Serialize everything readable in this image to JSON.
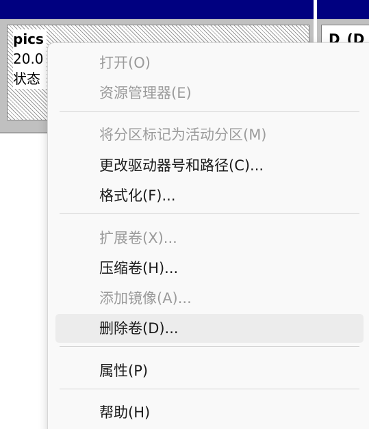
{
  "disk": {
    "volume_name": "pics",
    "volume_size_fragment": "20.0",
    "volume_status_fragment": "状态",
    "right_volume_fragment": "D_(D"
  },
  "menu": {
    "items": [
      {
        "label": "打开(O)",
        "enabled": false
      },
      {
        "label": "资源管理器(E)",
        "enabled": false
      },
      {
        "label": "将分区标记为活动分区(M)",
        "enabled": false
      },
      {
        "label": "更改驱动器号和路径(C)...",
        "enabled": true
      },
      {
        "label": "格式化(F)...",
        "enabled": true
      },
      {
        "label": "扩展卷(X)...",
        "enabled": false
      },
      {
        "label": "压缩卷(H)...",
        "enabled": true
      },
      {
        "label": "添加镜像(A)...",
        "enabled": false
      },
      {
        "label": "删除卷(D)...",
        "enabled": true,
        "highlighted": true
      },
      {
        "label": "属性(P)",
        "enabled": true
      },
      {
        "label": "帮助(H)",
        "enabled": true
      }
    ]
  },
  "colors": {
    "header": "#000080",
    "menu_background": "#f9f9f9",
    "hover_background": "#ececec",
    "disabled_text": "#9b9b9b",
    "enabled_text": "#1a1a1a"
  }
}
